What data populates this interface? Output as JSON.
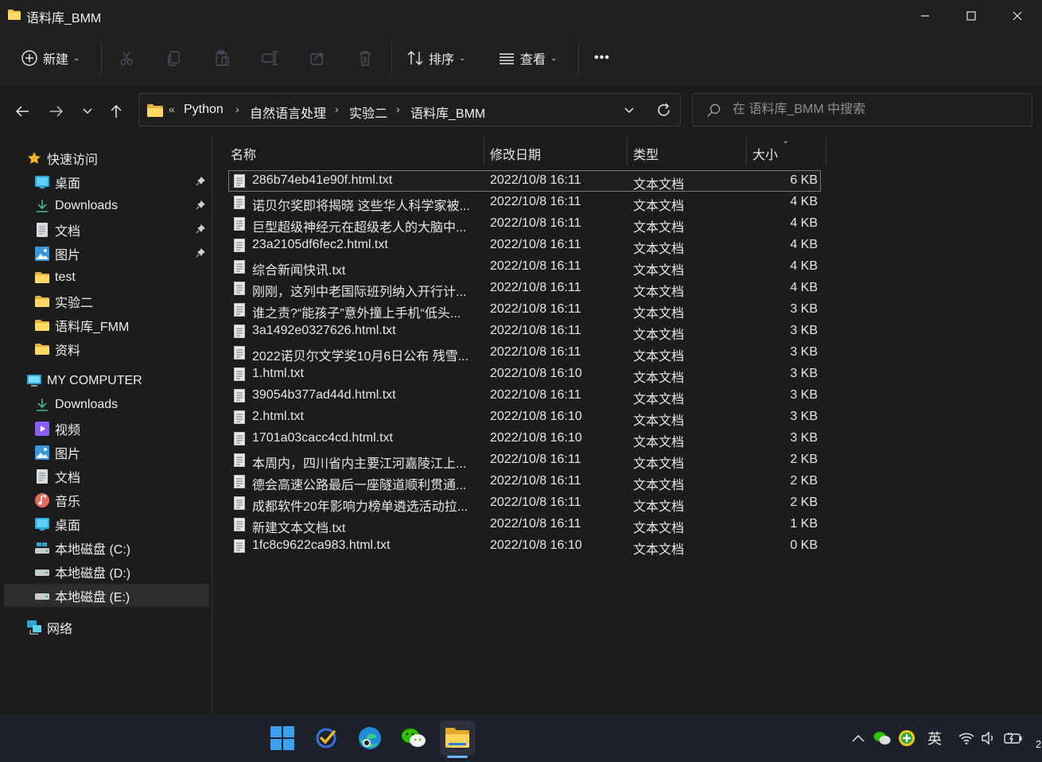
{
  "window": {
    "title": "语料库_BMM"
  },
  "toolbar": {
    "new_label": "新建",
    "sort_label": "排序",
    "view_label": "查看",
    "more_label": "•••"
  },
  "breadcrumb": {
    "overflow": "«",
    "segments": [
      "Python",
      "自然语言处理",
      "实验二",
      "语料库_BMM"
    ],
    "sep": "›"
  },
  "search": {
    "placeholder": "在 语料库_BMM 中搜索"
  },
  "sidebar": {
    "quick_access": "快速访问",
    "quick_items": [
      {
        "label": "桌面",
        "icon": "desktop-icon",
        "pinned": true
      },
      {
        "label": "Downloads",
        "icon": "download-icon",
        "pinned": true
      },
      {
        "label": "文档",
        "icon": "document-icon",
        "pinned": true
      },
      {
        "label": "图片",
        "icon": "pictures-icon",
        "pinned": true
      },
      {
        "label": "test",
        "icon": "folder-icon",
        "pinned": false
      },
      {
        "label": "实验二",
        "icon": "folder-icon",
        "pinned": false
      },
      {
        "label": "语料库_FMM",
        "icon": "folder-icon",
        "pinned": false
      },
      {
        "label": "资料",
        "icon": "folder-icon",
        "pinned": false
      }
    ],
    "computer": "MY COMPUTER",
    "computer_items": [
      {
        "label": "Downloads",
        "icon": "download-icon"
      },
      {
        "label": "视频",
        "icon": "video-icon"
      },
      {
        "label": "图片",
        "icon": "pictures-icon"
      },
      {
        "label": "文档",
        "icon": "document-icon"
      },
      {
        "label": "音乐",
        "icon": "music-icon"
      },
      {
        "label": "桌面",
        "icon": "desktop-icon"
      },
      {
        "label": "本地磁盘 (C:)",
        "icon": "system-drive-icon"
      },
      {
        "label": "本地磁盘 (D:)",
        "icon": "drive-icon"
      },
      {
        "label": "本地磁盘 (E:)",
        "icon": "drive-icon",
        "selected": true
      }
    ],
    "network": "网络"
  },
  "columns": {
    "name": "名称",
    "modified": "修改日期",
    "type": "类型",
    "size": "大小"
  },
  "files": [
    {
      "name": "286b74eb41e90f.html.txt",
      "date": "2022/10/8 16:11",
      "type": "文本文档",
      "size": "6 KB"
    },
    {
      "name": "诺贝尔奖即将揭晓 这些华人科学家被...",
      "date": "2022/10/8 16:11",
      "type": "文本文档",
      "size": "4 KB"
    },
    {
      "name": "巨型超级神经元在超级老人的大脑中...",
      "date": "2022/10/8 16:11",
      "type": "文本文档",
      "size": "4 KB"
    },
    {
      "name": "23a2105df6fec2.html.txt",
      "date": "2022/10/8 16:11",
      "type": "文本文档",
      "size": "4 KB"
    },
    {
      "name": "综合新闻快讯.txt",
      "date": "2022/10/8 16:11",
      "type": "文本文档",
      "size": "4 KB"
    },
    {
      "name": "刚刚，这列中老国际班列纳入开行计...",
      "date": "2022/10/8 16:11",
      "type": "文本文档",
      "size": "4 KB"
    },
    {
      "name": "谁之责?“能孩子”意外撞上手机“低头...",
      "date": "2022/10/8 16:11",
      "type": "文本文档",
      "size": "3 KB"
    },
    {
      "name": "3a1492e0327626.html.txt",
      "date": "2022/10/8 16:11",
      "type": "文本文档",
      "size": "3 KB"
    },
    {
      "name": "2022诺贝尔文学奖10月6日公布 残雪...",
      "date": "2022/10/8 16:11",
      "type": "文本文档",
      "size": "3 KB"
    },
    {
      "name": "1.html.txt",
      "date": "2022/10/8 16:10",
      "type": "文本文档",
      "size": "3 KB"
    },
    {
      "name": "39054b377ad44d.html.txt",
      "date": "2022/10/8 16:11",
      "type": "文本文档",
      "size": "3 KB"
    },
    {
      "name": "2.html.txt",
      "date": "2022/10/8 16:10",
      "type": "文本文档",
      "size": "3 KB"
    },
    {
      "name": "1701a03cacc4cd.html.txt",
      "date": "2022/10/8 16:10",
      "type": "文本文档",
      "size": "3 KB"
    },
    {
      "name": "本周内，四川省内主要江河嘉陵江上...",
      "date": "2022/10/8 16:11",
      "type": "文本文档",
      "size": "2 KB"
    },
    {
      "name": "德会高速公路最后一座隧道顺利贯通...",
      "date": "2022/10/8 16:11",
      "type": "文本文档",
      "size": "2 KB"
    },
    {
      "name": "成都软件20年影响力榜单遴选活动拉...",
      "date": "2022/10/8 16:11",
      "type": "文本文档",
      "size": "2 KB"
    },
    {
      "name": "新建文本文档.txt",
      "date": "2022/10/8 16:11",
      "type": "文本文档",
      "size": "1 KB"
    },
    {
      "name": "1fc8c9622ca983.html.txt",
      "date": "2022/10/8 16:10",
      "type": "文本文档",
      "size": "0 KB"
    }
  ],
  "taskbar": {
    "ime_label": "英",
    "clock_fragment": "2"
  },
  "colors": {
    "accent_folder": "#f2c94c",
    "taskbar_bg": "#1d2129",
    "window_bg": "#1c1c1c"
  }
}
